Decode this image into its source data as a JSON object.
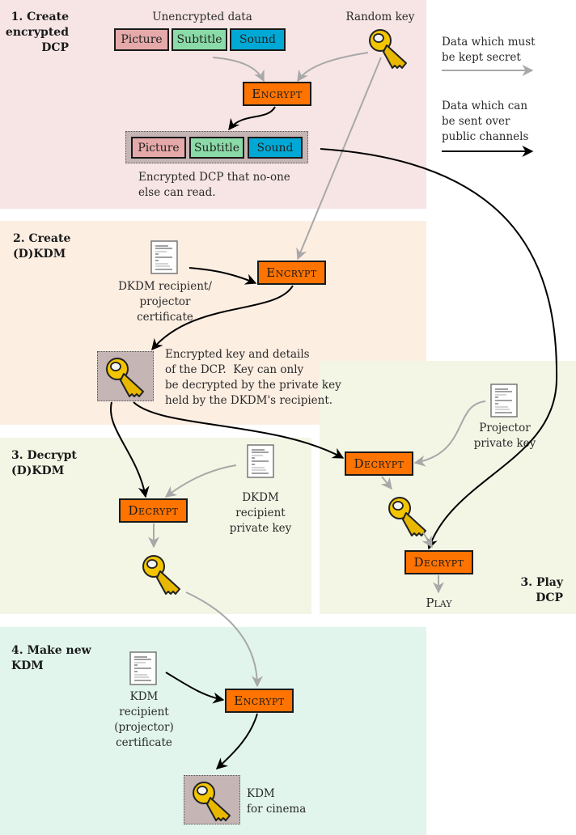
{
  "colors": {
    "stage1_bg": "#f7e5e5",
    "stage2_bg": "#fdeee2",
    "stage3_bg": "#f3f6e5",
    "stage4_bg": "#e1f5ec",
    "operation_fill": "#ff7300",
    "picture_fill": "#e5a9a9",
    "subtitle_fill": "#8adba7",
    "sound_fill": "#00a9d5",
    "secret_arrow": "#a8a8a8",
    "public_arrow": "#000000"
  },
  "stages": {
    "create_dcp": {
      "title": "1. Create\nencrypted\nDCP"
    },
    "create_kdm": {
      "title": "2. Create\n(D)KDM"
    },
    "decrypt_kdm": {
      "title": "3. Decrypt\n(D)KDM"
    },
    "play_dcp": {
      "title": "3. Play\nDCP"
    },
    "make_kdm": {
      "title": "4. Make new\nKDM"
    }
  },
  "stage1": {
    "unencrypted_label": "Unencrypted data",
    "random_key_label": "Random key",
    "tracks": [
      "Picture",
      "Subtitle",
      "Sound"
    ],
    "encrypt_label": "Encrypt",
    "encrypted_tracks": [
      "Picture",
      "Subtitle",
      "Sound"
    ],
    "encrypted_caption": "Encrypted DCP that no-one\nelse can read."
  },
  "stage2": {
    "certificate_label": "DKDM recipient/\nprojector\ncertificate",
    "encrypt_label": "Encrypt",
    "encrypted_key_caption": "Encrypted key and details\nof the DCP.  Key can only\nbe decrypted by the private key\nheld by the DKDM's recipient."
  },
  "stage3_decrypt": {
    "decrypt_label": "Decrypt",
    "private_key_label": "DKDM\nrecipient\nprivate key"
  },
  "stage3_play": {
    "projector_key_label": "Projector\nprivate key",
    "decrypt_key_label": "Decrypt",
    "decrypt_content_label": "Decrypt",
    "play_label": "Play"
  },
  "stage4": {
    "certificate_label": "KDM\nrecipient\n(projector)\ncertificate",
    "encrypt_label": "Encrypt",
    "kdm_label": "KDM\nfor cinema"
  },
  "legend": {
    "secret": "Data which must\nbe kept secret",
    "public": "Data which can\nbe sent over\npublic channels"
  },
  "icons": {
    "key": "key-icon",
    "document": "document-icon"
  }
}
